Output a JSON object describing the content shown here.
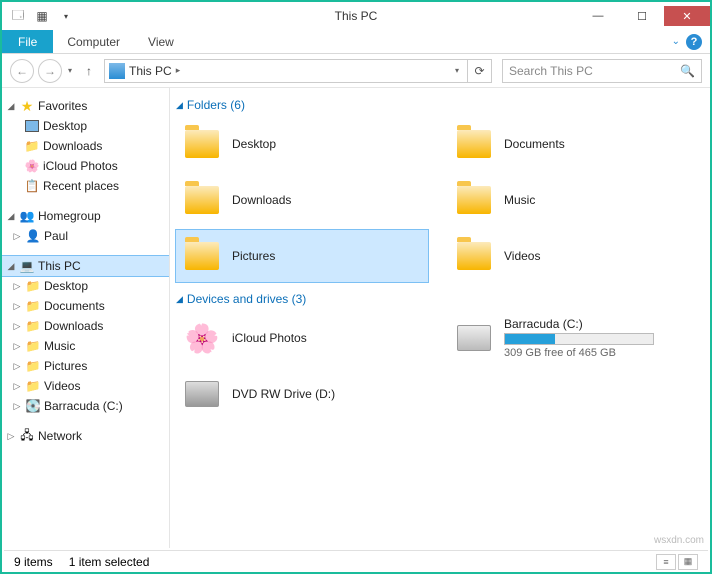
{
  "window": {
    "title": "This PC"
  },
  "ribbon": {
    "file": "File",
    "computer": "Computer",
    "view": "View"
  },
  "nav": {
    "breadcrumb": "This PC",
    "bc_sep": "▸",
    "search_placeholder": "Search This PC"
  },
  "sidebar": {
    "favorites": {
      "label": "Favorites",
      "items": [
        "Desktop",
        "Downloads",
        "iCloud Photos",
        "Recent places"
      ]
    },
    "homegroup": {
      "label": "Homegroup",
      "items": [
        "Paul"
      ]
    },
    "thispc": {
      "label": "This PC",
      "items": [
        "Desktop",
        "Documents",
        "Downloads",
        "Music",
        "Pictures",
        "Videos",
        "Barracuda (C:)"
      ]
    },
    "network": {
      "label": "Network"
    }
  },
  "sections": {
    "folders": {
      "title": "Folders (6)",
      "items": [
        "Desktop",
        "Documents",
        "Downloads",
        "Music",
        "Pictures",
        "Videos"
      ]
    },
    "drives": {
      "title": "Devices and drives (3)",
      "items": [
        {
          "label": "iCloud Photos"
        },
        {
          "label": "Barracuda (C:)",
          "sub": "309 GB free of 465 GB",
          "fill_pct": 34
        },
        {
          "label": "DVD RW Drive (D:)"
        }
      ]
    }
  },
  "status": {
    "count": "9 items",
    "selected": "1 item selected"
  },
  "watermark": "wsxdn.com"
}
